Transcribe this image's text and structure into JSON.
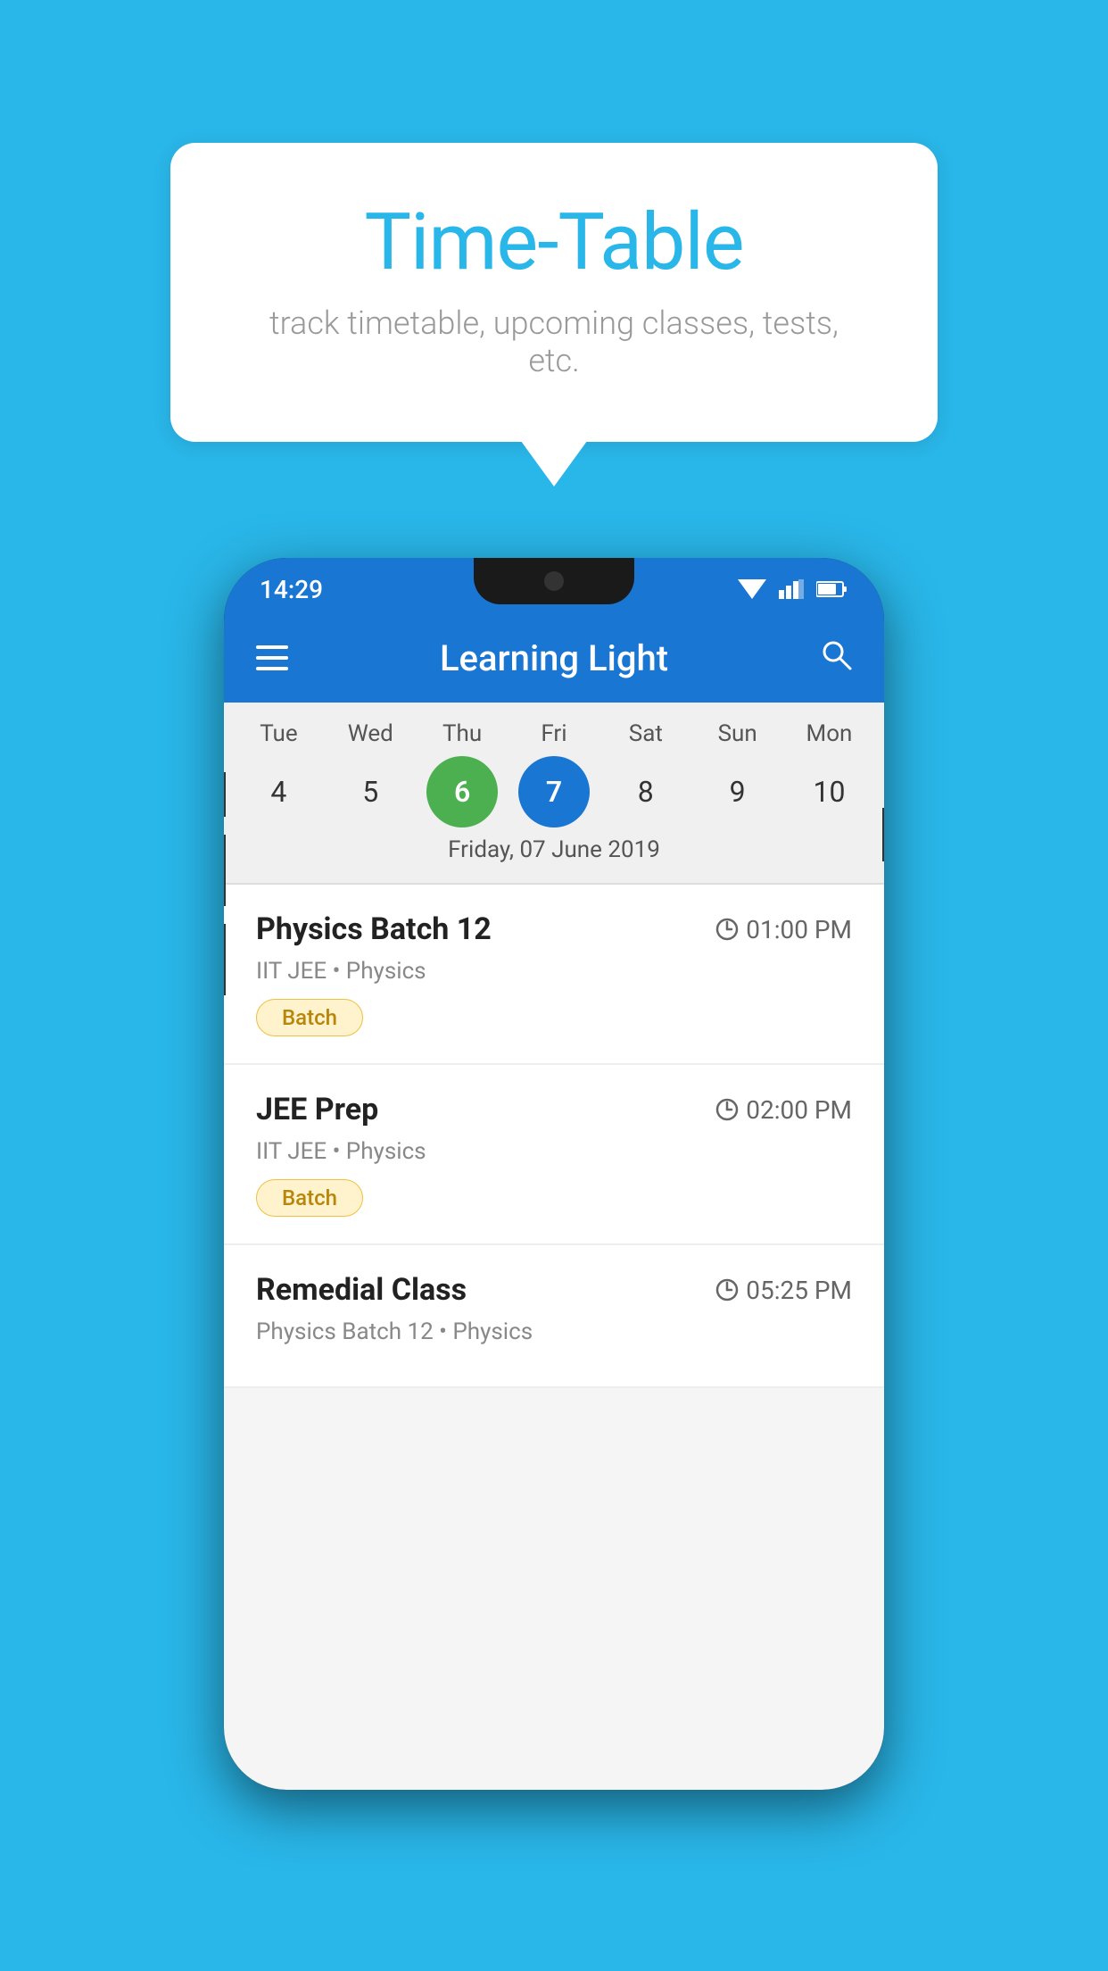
{
  "background_color": "#29b6e8",
  "hero": {
    "title": "Time-Table",
    "subtitle": "track timetable, upcoming classes, tests, etc."
  },
  "app": {
    "title": "Learning Light",
    "status_time": "14:29"
  },
  "calendar": {
    "selected_date_label": "Friday, 07 June 2019",
    "days": [
      {
        "label": "Tue",
        "num": "4",
        "state": "normal"
      },
      {
        "label": "Wed",
        "num": "5",
        "state": "normal"
      },
      {
        "label": "Thu",
        "num": "6",
        "state": "today"
      },
      {
        "label": "Fri",
        "num": "7",
        "state": "selected"
      },
      {
        "label": "Sat",
        "num": "8",
        "state": "normal"
      },
      {
        "label": "Sun",
        "num": "9",
        "state": "normal"
      },
      {
        "label": "Mon",
        "num": "10",
        "state": "normal"
      }
    ]
  },
  "classes": [
    {
      "name": "Physics Batch 12",
      "time": "01:00 PM",
      "subtitle": "IIT JEE • Physics",
      "tag": "Batch"
    },
    {
      "name": "JEE Prep",
      "time": "02:00 PM",
      "subtitle": "IIT JEE • Physics",
      "tag": "Batch"
    },
    {
      "name": "Remedial Class",
      "time": "05:25 PM",
      "subtitle": "Physics Batch 12 • Physics",
      "tag": ""
    }
  ],
  "labels": {
    "menu_icon": "☰",
    "search_icon": "🔍"
  }
}
